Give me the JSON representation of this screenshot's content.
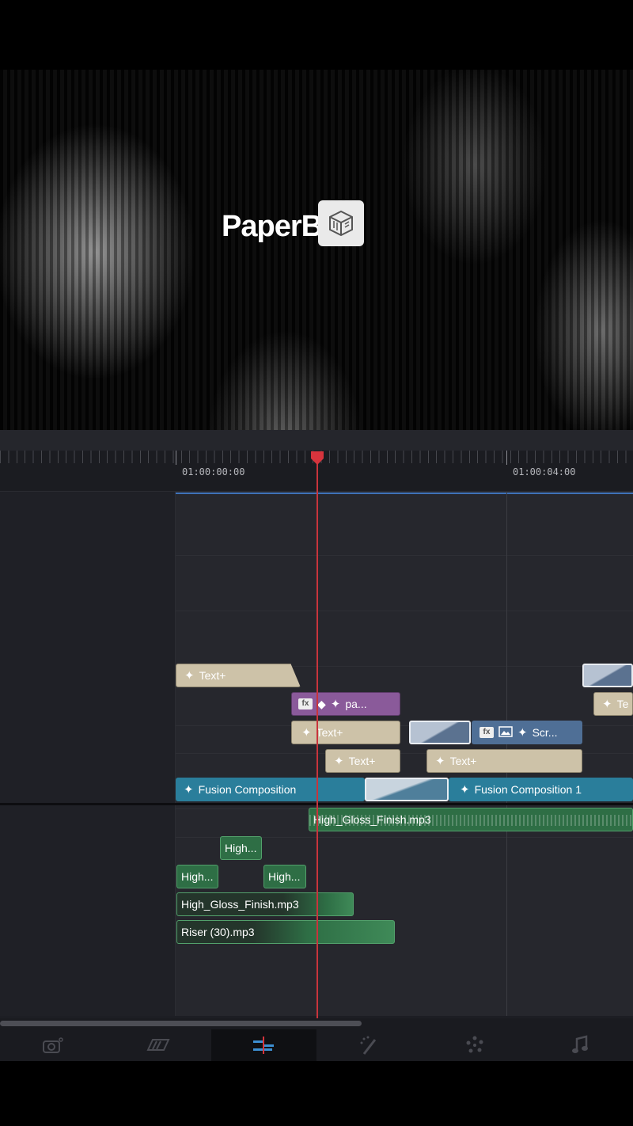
{
  "viewer": {
    "brand_text": "PaperB",
    "logo_icon": "cube-icon"
  },
  "ruler": {
    "timecodes": [
      "01:00:00:00",
      "01:00:04:00"
    ]
  },
  "clips": {
    "video": {
      "v5_text_a": "Text+",
      "v4_purple": "pa...",
      "v4_text_right": "Te",
      "v3_text": "Text+",
      "v3_scr": "Scr...",
      "v2_text_a": "Text+",
      "v2_text_b": "Text+",
      "v1_fusion_a": "Fusion Composition",
      "v1_fusion_b": "Fusion Composition 1"
    },
    "audio": {
      "a1": "High_Gloss_Finish.mp3",
      "a2": "High...",
      "a3_a": "High...",
      "a3_b": "High...",
      "a4": "High_Gloss_Finish.mp3",
      "a5": "Riser (30).mp3"
    }
  },
  "page_nav": {
    "items": [
      {
        "icon": "media-icon",
        "active": false
      },
      {
        "icon": "cut-icon",
        "active": false
      },
      {
        "icon": "edit-icon",
        "active": true
      },
      {
        "icon": "fusion-icon",
        "active": false
      },
      {
        "icon": "color-icon",
        "active": false
      },
      {
        "icon": "fairlight-icon",
        "active": false
      }
    ]
  },
  "colors": {
    "playhead": "#c8343c",
    "text_clip": "#cdc2a8",
    "fusion_clip": "#2a7e9b",
    "audio_clip": "#2e6e45",
    "effect_clip": "#8a5a9a"
  }
}
